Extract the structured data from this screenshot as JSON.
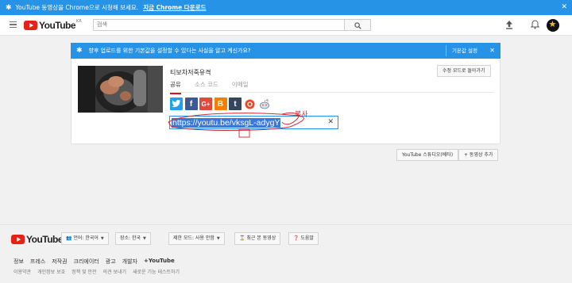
{
  "promo": {
    "message": "YouTube 동영상을 Chrome으로 시청해 보세요.",
    "download_link": "지금 Chrome 다운로드",
    "close": "✕"
  },
  "masthead": {
    "logo_text": "YouTube",
    "region": "KR",
    "search_placeholder": "검색"
  },
  "info_bar": {
    "message": "향후 업로드를 위한 기본값을 설정할 수 있다는 사실을 알고 계신가요?",
    "settings_button": "기본값 설정",
    "close": "✕"
  },
  "share": {
    "video_title": "티보차저죽유격",
    "edit_button": "수정 모드로 돌아가기",
    "tabs": [
      {
        "label": "공유",
        "active": true
      },
      {
        "label": "소스 코드",
        "active": false
      },
      {
        "label": "이메일",
        "active": false
      }
    ],
    "socials": [
      {
        "icon": "twitter-icon",
        "glyph": "t",
        "color": "#1da1f2"
      },
      {
        "icon": "facebook-icon",
        "glyph": "f",
        "color": "#3b5998"
      },
      {
        "icon": "google-plus-icon",
        "glyph": "G+",
        "color": "#dd4b39"
      },
      {
        "icon": "blogger-icon",
        "glyph": "B",
        "color": "#f57d00"
      },
      {
        "icon": "tumblr-icon",
        "glyph": "t",
        "color": "#35465c"
      },
      {
        "icon": "stumbleupon-icon",
        "glyph": "ᴥ",
        "color": "#eb4823"
      },
      {
        "icon": "reddit-icon",
        "glyph": "●",
        "color": "#cee3f8"
      }
    ],
    "url": "https://youtu.be/vksgL-adygY",
    "clear": "✕",
    "annotation": "복사"
  },
  "actions": {
    "studio_button": "YouTube 스튜디오(베타)",
    "add_video_button": "+ 동영상 추가"
  },
  "footer": {
    "logo_text": "YouTube",
    "buttons": {
      "language": "언어: 한국어",
      "location": "장소: 한국",
      "restricted": "제한 모드: 사용 안함",
      "history": "최근 본 동영상",
      "help": "도움말"
    },
    "links": [
      "정보",
      "프레스",
      "저작권",
      "크리에이터",
      "광고",
      "개발자",
      "+YouTube"
    ],
    "links2": [
      "이용약관",
      "개인정보 보호",
      "정책 및 안전",
      "의견 보내기",
      "새로운 기능 테스트하기"
    ]
  },
  "colors": {
    "brand_red": "#e62117",
    "info_blue": "#2793e6",
    "selection_blue": "#3b78d6",
    "annotation_red": "#d42a2a"
  }
}
